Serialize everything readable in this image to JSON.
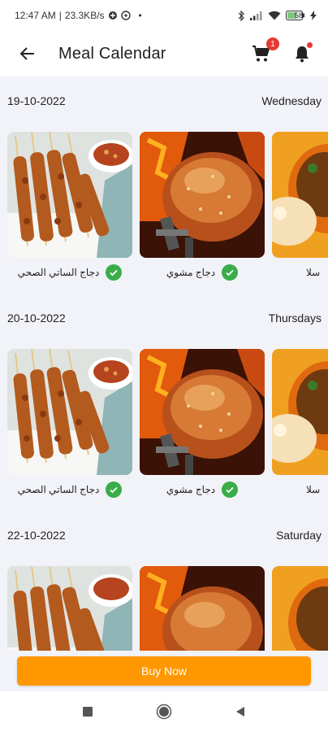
{
  "status_bar": {
    "time": "12:47 AM",
    "network_speed": "23.3KB/s",
    "battery": "58",
    "icons": [
      "data-saver-icon",
      "sync-icon",
      "bluetooth-icon",
      "signal-icon",
      "wifi-icon",
      "battery-icon",
      "charging-icon"
    ]
  },
  "header": {
    "title": "Meal Calendar",
    "cart_count": "1",
    "back_icon": "arrow-left-icon",
    "cart_icon": "cart-icon",
    "bell_icon": "bell-icon"
  },
  "days": [
    {
      "date": "19-10-2022",
      "weekday": "Wednesday",
      "meals": [
        {
          "name": "دجاج الساتي الصحي",
          "selected": true,
          "image": "chicken-satay-skewers"
        },
        {
          "name": "دجاج مشوي",
          "selected": true,
          "image": "grilled-chicken"
        },
        {
          "name": "سلا",
          "selected": false,
          "image": "salad-bowl"
        }
      ]
    },
    {
      "date": "20-10-2022",
      "weekday": "Thursdays",
      "meals": [
        {
          "name": "دجاج الساتي الصحي",
          "selected": true,
          "image": "chicken-satay-skewers"
        },
        {
          "name": "دجاج مشوي",
          "selected": true,
          "image": "grilled-chicken"
        },
        {
          "name": "سلا",
          "selected": false,
          "image": "salad-bowl"
        }
      ]
    },
    {
      "date": "22-10-2022",
      "weekday": "Saturday",
      "meals": [
        {
          "name": "",
          "selected": false,
          "image": "chicken-satay-skewers"
        },
        {
          "name": "",
          "selected": false,
          "image": "grilled-chicken"
        },
        {
          "name": "",
          "selected": false,
          "image": "salad-bowl"
        }
      ]
    }
  ],
  "footer": {
    "buy_label": "Buy Now"
  },
  "nav_bar": {
    "icons": [
      "recents-square-icon",
      "home-circle-icon",
      "back-triangle-icon"
    ]
  },
  "colors": {
    "accent": "#ff9800",
    "check": "#3aad4a",
    "badge": "#e53935",
    "background": "#f2f3f8"
  }
}
